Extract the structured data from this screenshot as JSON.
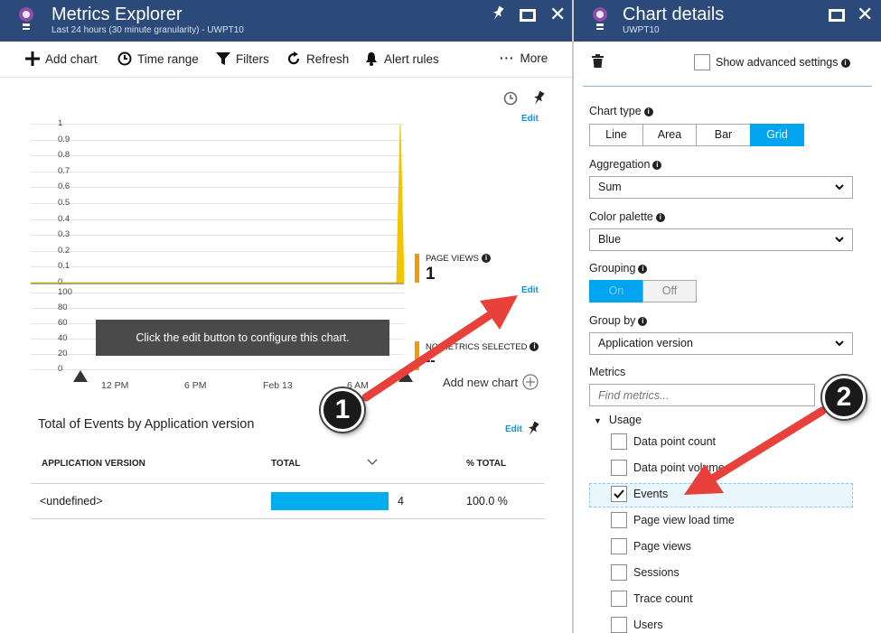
{
  "left_blade": {
    "title": "Metrics Explorer",
    "subtitle": "Last 24 hours (30 minute granularity) - UWPT10",
    "toolbar": {
      "add_chart": "Add chart",
      "time_range": "Time range",
      "filters": "Filters",
      "refresh": "Refresh",
      "alert_rules": "Alert rules",
      "more": "More"
    },
    "chart1": {
      "edit": "Edit",
      "metric_label": "PAGE VIEWS",
      "metric_value": "1"
    },
    "chart2": {
      "edit": "Edit",
      "overlay": "Click the edit button to configure this chart.",
      "metric_label": "NO METRICS SELECTED",
      "metric_value": "--"
    },
    "x_ticks": [
      "12 PM",
      "6 PM",
      "Feb 13",
      "6 AM"
    ],
    "add_new_chart": "Add new chart",
    "table": {
      "title": "Total of Events by Application version",
      "edit": "Edit",
      "columns": [
        "APPLICATION VERSION",
        "TOTAL",
        "% TOTAL"
      ],
      "rows": [
        {
          "version": "<undefined>",
          "total": "4",
          "pct": "100.0 %",
          "fraction": 1.0
        }
      ]
    }
  },
  "chart_data": [
    {
      "type": "line",
      "series": [
        {
          "name": "PAGE VIEWS"
        }
      ],
      "y_ticks": [
        "1",
        "0.9",
        "0.8",
        "0.7",
        "0.6",
        "0.5",
        "0.4",
        "0.3",
        "0.2",
        "0.1",
        "0"
      ],
      "ylim": [
        0,
        1
      ],
      "grid": true,
      "color": "#f2c500",
      "values": [
        0,
        1
      ]
    },
    {
      "type": "line",
      "y_ticks": [
        "100",
        "80",
        "60",
        "40",
        "20",
        "0"
      ],
      "ylim": [
        0,
        100
      ],
      "grid": true
    }
  ],
  "right_blade": {
    "title": "Chart details",
    "subtitle": "UWPT10",
    "show_advanced": "Show advanced settings",
    "chart_type_label": "Chart type",
    "chart_types": [
      "Line",
      "Area",
      "Bar",
      "Grid"
    ],
    "chart_type_selected": "Grid",
    "aggregation_label": "Aggregation",
    "aggregation_value": "Sum",
    "palette_label": "Color palette",
    "palette_value": "Blue",
    "grouping_label": "Grouping",
    "grouping_on": "On",
    "grouping_off": "Off",
    "group_by_label": "Group by",
    "group_by_value": "Application version",
    "metrics_label": "Metrics",
    "metrics_placeholder": "Find metrics...",
    "usage_group": "Usage",
    "metrics": [
      {
        "label": "Data point count",
        "checked": false
      },
      {
        "label": "Data point volume",
        "checked": false
      },
      {
        "label": "Events",
        "checked": true
      },
      {
        "label": "Page view load time",
        "checked": false
      },
      {
        "label": "Page views",
        "checked": false
      },
      {
        "label": "Sessions",
        "checked": false
      },
      {
        "label": "Trace count",
        "checked": false
      },
      {
        "label": "Users",
        "checked": false
      }
    ]
  },
  "callouts": [
    "1",
    "2"
  ],
  "colors": {
    "header": "#2b4a7a",
    "accent": "#00a4ef",
    "series_yellow": "#f2c500",
    "metric_orange": "#f29b00",
    "arrow": "#e8413c"
  }
}
